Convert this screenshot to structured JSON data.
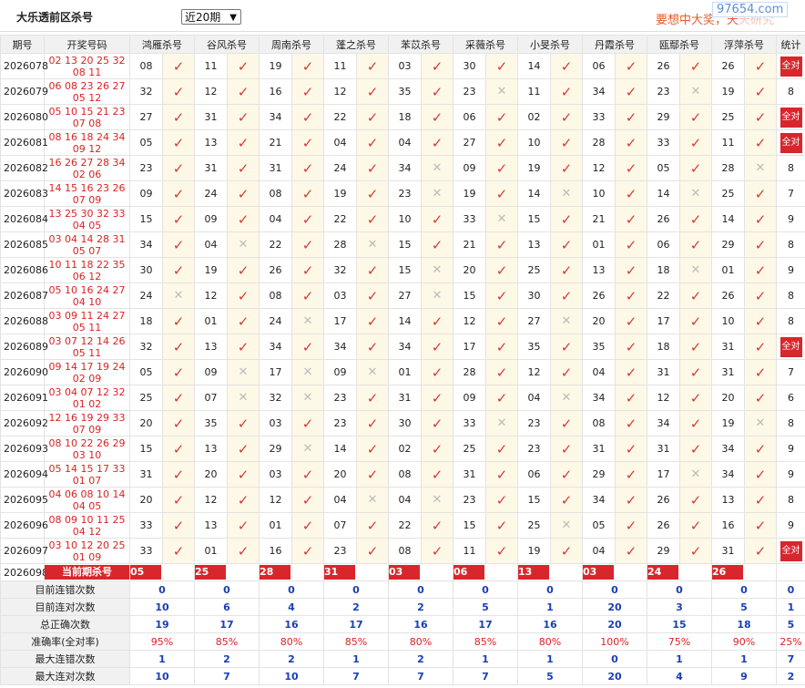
{
  "header": {
    "title": "大乐透前区杀号",
    "period_select": "近20期",
    "banner_text": "要想中大奖，天",
    "banner_fade": "天研究",
    "watermark": "97654.com"
  },
  "columns": [
    "期号",
    "开奖号码",
    "鸿雁杀号",
    "谷风杀号",
    "周南杀号",
    "蓬之杀号",
    "苯苡杀号",
    "采薇杀号",
    "小旻杀号",
    "丹霞杀号",
    "瓯鄢杀号",
    "浮萍杀号",
    "统计"
  ],
  "rows": [
    {
      "issue": "2026078",
      "n1": "02 13 20 25 32",
      "n2": "08 11",
      "k": [
        [
          "08",
          1
        ],
        [
          "11",
          1
        ],
        [
          "19",
          1
        ],
        [
          "11",
          1
        ],
        [
          "03",
          1
        ],
        [
          "30",
          1
        ],
        [
          "14",
          1
        ],
        [
          "06",
          1
        ],
        [
          "26",
          1
        ],
        [
          "26",
          1
        ]
      ],
      "stat": "全对"
    },
    {
      "issue": "2026079",
      "n1": "06 08 23 26 27",
      "n2": "05 12",
      "k": [
        [
          "32",
          1
        ],
        [
          "12",
          1
        ],
        [
          "16",
          1
        ],
        [
          "12",
          1
        ],
        [
          "35",
          1
        ],
        [
          "23",
          0
        ],
        [
          "11",
          1
        ],
        [
          "34",
          1
        ],
        [
          "23",
          0
        ],
        [
          "19",
          1
        ]
      ],
      "stat": "8"
    },
    {
      "issue": "2026080",
      "n1": "05 10 15 21 23",
      "n2": "07 08",
      "k": [
        [
          "27",
          1
        ],
        [
          "31",
          1
        ],
        [
          "34",
          1
        ],
        [
          "22",
          1
        ],
        [
          "18",
          1
        ],
        [
          "06",
          1
        ],
        [
          "02",
          1
        ],
        [
          "33",
          1
        ],
        [
          "29",
          1
        ],
        [
          "25",
          1
        ]
      ],
      "stat": "全对"
    },
    {
      "issue": "2026081",
      "n1": "08 16 18 24 34",
      "n2": "09 12",
      "k": [
        [
          "05",
          1
        ],
        [
          "13",
          1
        ],
        [
          "21",
          1
        ],
        [
          "04",
          1
        ],
        [
          "04",
          1
        ],
        [
          "27",
          1
        ],
        [
          "10",
          1
        ],
        [
          "28",
          1
        ],
        [
          "33",
          1
        ],
        [
          "11",
          1
        ]
      ],
      "stat": "全对"
    },
    {
      "issue": "2026082",
      "n1": "16 26 27 28 34",
      "n2": "02 06",
      "k": [
        [
          "23",
          1
        ],
        [
          "31",
          1
        ],
        [
          "31",
          1
        ],
        [
          "24",
          1
        ],
        [
          "34",
          0
        ],
        [
          "09",
          1
        ],
        [
          "19",
          1
        ],
        [
          "12",
          1
        ],
        [
          "05",
          1
        ],
        [
          "28",
          0
        ]
      ],
      "stat": "8"
    },
    {
      "issue": "2026083",
      "n1": "14 15 16 23 26",
      "n2": "07 09",
      "k": [
        [
          "09",
          1
        ],
        [
          "24",
          1
        ],
        [
          "08",
          1
        ],
        [
          "19",
          1
        ],
        [
          "23",
          0
        ],
        [
          "19",
          1
        ],
        [
          "14",
          0
        ],
        [
          "10",
          1
        ],
        [
          "14",
          0
        ],
        [
          "25",
          1
        ]
      ],
      "stat": "7"
    },
    {
      "issue": "2026084",
      "n1": "13 25 30 32 33",
      "n2": "04 05",
      "k": [
        [
          "15",
          1
        ],
        [
          "09",
          1
        ],
        [
          "04",
          1
        ],
        [
          "22",
          1
        ],
        [
          "10",
          1
        ],
        [
          "33",
          0
        ],
        [
          "15",
          1
        ],
        [
          "21",
          1
        ],
        [
          "26",
          1
        ],
        [
          "14",
          1
        ]
      ],
      "stat": "9"
    },
    {
      "issue": "2026085",
      "n1": "03 04 14 28 31",
      "n2": "05 07",
      "k": [
        [
          "34",
          1
        ],
        [
          "04",
          0
        ],
        [
          "22",
          1
        ],
        [
          "28",
          0
        ],
        [
          "15",
          1
        ],
        [
          "21",
          1
        ],
        [
          "13",
          1
        ],
        [
          "01",
          1
        ],
        [
          "06",
          1
        ],
        [
          "29",
          1
        ]
      ],
      "stat": "8"
    },
    {
      "issue": "2026086",
      "n1": "10 11 18 22 35",
      "n2": "06 12",
      "k": [
        [
          "30",
          1
        ],
        [
          "19",
          1
        ],
        [
          "26",
          1
        ],
        [
          "32",
          1
        ],
        [
          "15",
          0
        ],
        [
          "20",
          1
        ],
        [
          "25",
          1
        ],
        [
          "13",
          1
        ],
        [
          "18",
          0
        ],
        [
          "01",
          1
        ]
      ],
      "stat": "9"
    },
    {
      "issue": "2026087",
      "n1": "05 10 16 24 27",
      "n2": "04 10",
      "k": [
        [
          "24",
          0
        ],
        [
          "12",
          1
        ],
        [
          "08",
          1
        ],
        [
          "03",
          1
        ],
        [
          "27",
          0
        ],
        [
          "15",
          1
        ],
        [
          "30",
          1
        ],
        [
          "26",
          1
        ],
        [
          "22",
          1
        ],
        [
          "26",
          1
        ]
      ],
      "stat": "8"
    },
    {
      "issue": "2026088",
      "n1": "03 09 11 24 27",
      "n2": "05 11",
      "k": [
        [
          "18",
          1
        ],
        [
          "01",
          1
        ],
        [
          "24",
          0
        ],
        [
          "17",
          1
        ],
        [
          "14",
          1
        ],
        [
          "12",
          1
        ],
        [
          "27",
          0
        ],
        [
          "20",
          1
        ],
        [
          "17",
          1
        ],
        [
          "10",
          1
        ]
      ],
      "stat": "8"
    },
    {
      "issue": "2026089",
      "n1": "03 07 12 14 26",
      "n2": "05 11",
      "k": [
        [
          "32",
          1
        ],
        [
          "13",
          1
        ],
        [
          "34",
          1
        ],
        [
          "34",
          1
        ],
        [
          "34",
          1
        ],
        [
          "17",
          1
        ],
        [
          "35",
          1
        ],
        [
          "35",
          1
        ],
        [
          "18",
          1
        ],
        [
          "31",
          1
        ]
      ],
      "stat": "全对"
    },
    {
      "issue": "2026090",
      "n1": "09 14 17 19 24",
      "n2": "02 09",
      "k": [
        [
          "05",
          1
        ],
        [
          "09",
          0
        ],
        [
          "17",
          0
        ],
        [
          "09",
          0
        ],
        [
          "01",
          1
        ],
        [
          "28",
          1
        ],
        [
          "12",
          1
        ],
        [
          "04",
          1
        ],
        [
          "31",
          1
        ],
        [
          "31",
          1
        ]
      ],
      "stat": "7"
    },
    {
      "issue": "2026091",
      "n1": "03 04 07 12 32",
      "n2": "01 02",
      "k": [
        [
          "25",
          1
        ],
        [
          "07",
          0
        ],
        [
          "32",
          0
        ],
        [
          "23",
          1
        ],
        [
          "31",
          1
        ],
        [
          "09",
          1
        ],
        [
          "04",
          0
        ],
        [
          "34",
          1
        ],
        [
          "12",
          1
        ],
        [
          "20",
          1
        ]
      ],
      "stat": "6"
    },
    {
      "issue": "2026092",
      "n1": "12 16 19 29 33",
      "n2": "07 09",
      "k": [
        [
          "20",
          1
        ],
        [
          "35",
          1
        ],
        [
          "03",
          1
        ],
        [
          "23",
          1
        ],
        [
          "30",
          1
        ],
        [
          "33",
          0
        ],
        [
          "23",
          1
        ],
        [
          "08",
          1
        ],
        [
          "34",
          1
        ],
        [
          "19",
          0
        ]
      ],
      "stat": "8"
    },
    {
      "issue": "2026093",
      "n1": "08 10 22 26 29",
      "n2": "03 10",
      "k": [
        [
          "15",
          1
        ],
        [
          "13",
          1
        ],
        [
          "29",
          0
        ],
        [
          "14",
          1
        ],
        [
          "02",
          1
        ],
        [
          "25",
          1
        ],
        [
          "23",
          1
        ],
        [
          "31",
          1
        ],
        [
          "31",
          1
        ],
        [
          "34",
          1
        ]
      ],
      "stat": "9"
    },
    {
      "issue": "2026094",
      "n1": "05 14 15 17 33",
      "n2": "01 07",
      "k": [
        [
          "31",
          1
        ],
        [
          "20",
          1
        ],
        [
          "03",
          1
        ],
        [
          "20",
          1
        ],
        [
          "08",
          1
        ],
        [
          "31",
          1
        ],
        [
          "06",
          1
        ],
        [
          "29",
          1
        ],
        [
          "17",
          0
        ],
        [
          "34",
          1
        ]
      ],
      "stat": "9"
    },
    {
      "issue": "2026095",
      "n1": "04 06 08 10 14",
      "n2": "04 05",
      "k": [
        [
          "20",
          1
        ],
        [
          "12",
          1
        ],
        [
          "12",
          1
        ],
        [
          "04",
          0
        ],
        [
          "04",
          0
        ],
        [
          "23",
          1
        ],
        [
          "15",
          1
        ],
        [
          "34",
          1
        ],
        [
          "26",
          1
        ],
        [
          "13",
          1
        ]
      ],
      "stat": "8"
    },
    {
      "issue": "2026096",
      "n1": "08 09 10 11 25",
      "n2": "04 12",
      "k": [
        [
          "33",
          1
        ],
        [
          "13",
          1
        ],
        [
          "01",
          1
        ],
        [
          "07",
          1
        ],
        [
          "22",
          1
        ],
        [
          "15",
          1
        ],
        [
          "25",
          0
        ],
        [
          "05",
          1
        ],
        [
          "26",
          1
        ],
        [
          "16",
          1
        ]
      ],
      "stat": "9"
    },
    {
      "issue": "2026097",
      "n1": "03 10 12 20 25",
      "n2": "01 09",
      "k": [
        [
          "33",
          1
        ],
        [
          "01",
          1
        ],
        [
          "16",
          1
        ],
        [
          "23",
          1
        ],
        [
          "08",
          1
        ],
        [
          "11",
          1
        ],
        [
          "19",
          1
        ],
        [
          "04",
          1
        ],
        [
          "29",
          1
        ],
        [
          "31",
          1
        ]
      ],
      "stat": "全对"
    }
  ],
  "current": {
    "issue": "2026098",
    "label": "当前期杀号",
    "nums": [
      "05",
      "25",
      "28",
      "31",
      "03",
      "06",
      "13",
      "03",
      "24",
      "26"
    ]
  },
  "summary": [
    {
      "label": "目前连错次数",
      "cls": "blue",
      "vals": [
        "0",
        "0",
        "0",
        "0",
        "0",
        "0",
        "0",
        "0",
        "0",
        "0",
        "0"
      ]
    },
    {
      "label": "目前连对次数",
      "cls": "blue",
      "vals": [
        "10",
        "6",
        "4",
        "2",
        "2",
        "5",
        "1",
        "20",
        "3",
        "5",
        "1"
      ]
    },
    {
      "label": "总正确次数",
      "cls": "blue",
      "vals": [
        "19",
        "17",
        "16",
        "17",
        "16",
        "17",
        "16",
        "20",
        "15",
        "18",
        "5"
      ]
    },
    {
      "label": "准确率(全对率)",
      "cls": "red",
      "vals": [
        "95%",
        "85%",
        "80%",
        "85%",
        "80%",
        "85%",
        "80%",
        "100%",
        "75%",
        "90%",
        "25%"
      ]
    },
    {
      "label": "最大连错次数",
      "cls": "blue",
      "vals": [
        "1",
        "2",
        "2",
        "1",
        "2",
        "1",
        "1",
        "0",
        "1",
        "1",
        "7"
      ]
    },
    {
      "label": "最大连对次数",
      "cls": "blue",
      "vals": [
        "10",
        "7",
        "10",
        "7",
        "7",
        "7",
        "5",
        "20",
        "4",
        "9",
        "2"
      ]
    }
  ],
  "icons": {
    "correct": "check-icon",
    "wrong": "cross-icon"
  }
}
